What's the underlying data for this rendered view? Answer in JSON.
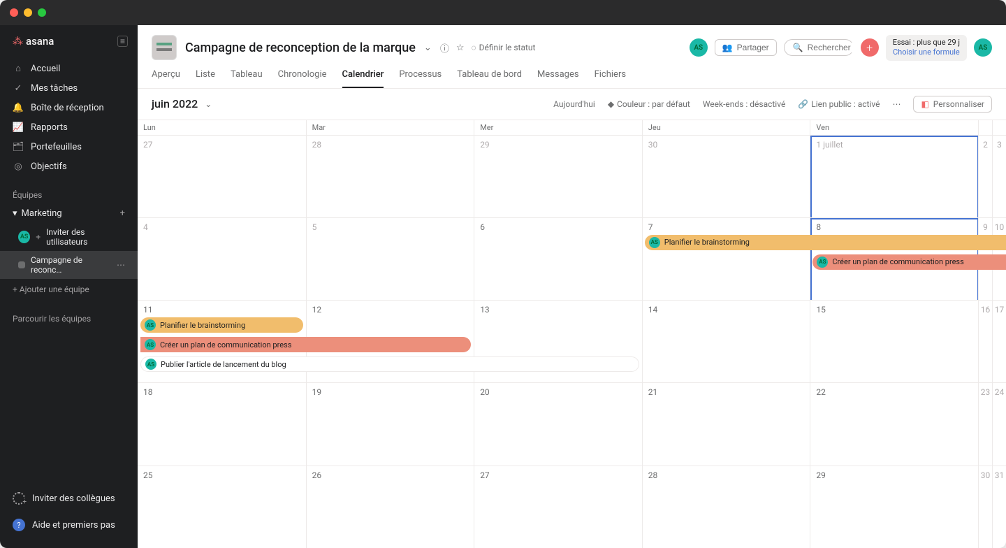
{
  "app": {
    "name": "asana"
  },
  "sidebar": {
    "nav": [
      {
        "label": "Accueil",
        "icon": "home"
      },
      {
        "label": "Mes tâches",
        "icon": "check"
      },
      {
        "label": "Boîte de réception",
        "icon": "bell"
      },
      {
        "label": "Rapports",
        "icon": "chart"
      },
      {
        "label": "Portefeuilles",
        "icon": "folder"
      },
      {
        "label": "Objectifs",
        "icon": "target"
      }
    ],
    "teams_label": "Équipes",
    "team": {
      "name": "Marketing"
    },
    "invite_users": "Inviter des utilisateurs",
    "project": "Campagne de reconc…",
    "add_team": "Ajouter une équipe",
    "browse_teams": "Parcourir les équipes",
    "invite": "Inviter des collègues",
    "help": "Aide et premiers pas"
  },
  "header": {
    "title": "Campagne de reconception de la marque",
    "set_status": "Définir le statut",
    "share": "Partager",
    "search_placeholder": "Rechercher",
    "trial_line": "Essai : plus que 29 j",
    "trial_link": "Choisir une formule",
    "avatar_initials": "AS",
    "tabs": [
      "Aperçu",
      "Liste",
      "Tableau",
      "Chronologie",
      "Calendrier",
      "Processus",
      "Tableau de bord",
      "Messages",
      "Fichiers"
    ],
    "active_tab": "Calendrier"
  },
  "subheader": {
    "month": "juin 2022",
    "today": "Aujourd'hui",
    "color": "Couleur : par défaut",
    "weekends": "Week-ends : désactivé",
    "publiclink": "Lien public : activé",
    "customize": "Personnaliser"
  },
  "days": [
    "Lun",
    "Mar",
    "Mer",
    "Jeu",
    "Ven"
  ],
  "weeks": [
    {
      "cells": [
        {
          "num": "27",
          "out": true
        },
        {
          "num": "28",
          "out": true
        },
        {
          "num": "29",
          "out": true
        },
        {
          "num": "30",
          "out": true
        },
        {
          "num": "1 juillet",
          "today": true,
          "out": true
        }
      ],
      "sat": "2",
      "sun": "3"
    },
    {
      "cells": [
        {
          "num": "4",
          "out": true
        },
        {
          "num": "5",
          "out": true
        },
        {
          "num": "6"
        },
        {
          "num": "7"
        },
        {
          "num": "8",
          "today": true
        }
      ],
      "sat": "9",
      "sun": "10",
      "events": [
        {
          "row": 0,
          "color": "yellow",
          "text": "Planifier le brainstorming",
          "startCol": 3,
          "endCol": 5,
          "openRight": true,
          "av": "AS"
        },
        {
          "row": 1,
          "color": "coral",
          "text": "Créer un plan de communication press",
          "startCol": 4,
          "endCol": 5,
          "openRight": true,
          "av": "AS"
        }
      ]
    },
    {
      "cells": [
        {
          "num": "11"
        },
        {
          "num": "12"
        },
        {
          "num": "13"
        },
        {
          "num": "14"
        },
        {
          "num": "15"
        }
      ],
      "sat": "16",
      "sun": "17",
      "events": [
        {
          "row": 0,
          "color": "yellow",
          "text": "Planifier le brainstorming",
          "startCol": 0,
          "endCol": 0,
          "av": "AS"
        },
        {
          "row": 1,
          "color": "coral",
          "text": "Créer un plan de communication press",
          "startCol": 0,
          "endCol": 1,
          "openLeft": true,
          "av": "AS"
        },
        {
          "row": 2,
          "color": "white",
          "text": "Publier l'article de lancement du blog",
          "startCol": 0,
          "endCol": 2,
          "av": "AS"
        }
      ]
    },
    {
      "cells": [
        {
          "num": "18"
        },
        {
          "num": "19"
        },
        {
          "num": "20"
        },
        {
          "num": "21"
        },
        {
          "num": "22"
        }
      ],
      "sat": "23",
      "sun": "24"
    },
    {
      "cells": [
        {
          "num": "25"
        },
        {
          "num": "26"
        },
        {
          "num": "27"
        },
        {
          "num": "28"
        },
        {
          "num": "29"
        }
      ],
      "sat": "30",
      "sun": "31"
    }
  ]
}
